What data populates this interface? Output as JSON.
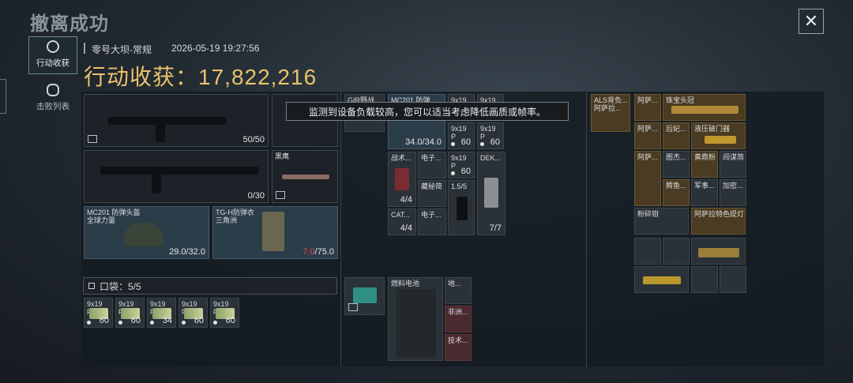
{
  "header": {
    "title": "撤离成功",
    "close_icon": "close-icon"
  },
  "side_tabs": [
    {
      "label": "行动收获",
      "icon": "loot-icon",
      "active": true
    },
    {
      "label": "击败列表",
      "icon": "skull-icon",
      "active": false
    }
  ],
  "meta": {
    "map": "零号大坝-常规",
    "time": "2026-05-19 19:27:56"
  },
  "harvest": {
    "label": "行动收获：",
    "value": "17,822,216"
  },
  "toast": "监测到设备负载较高，您可以适当考虑降低画质或帧率。",
  "equipment": {
    "primary_ammo": "50/50",
    "secondary_ammo": "0/30",
    "melee_label": "黑鹰",
    "helmet": {
      "name": "MC201 防弹头盔",
      "sub": "全球力量",
      "dur": "29.0/32.0"
    },
    "armor": {
      "name": "TG-H防弹衣",
      "sub": "三角洲",
      "dur_cur": "7.0",
      "dur_max": "/75.0"
    }
  },
  "pocket": {
    "label": "口袋：5/5",
    "ammo": [
      {
        "name": "9x19",
        "sub": "P",
        "count": "60"
      },
      {
        "name": "9x19",
        "sub": "P",
        "count": "60"
      },
      {
        "name": "9x19",
        "sub": "P",
        "count": "34"
      },
      {
        "name": "9x19",
        "sub": "P",
        "count": "60"
      },
      {
        "name": "9x19",
        "sub": "P",
        "count": "60"
      }
    ]
  },
  "chest": {
    "gir": "GIR野战",
    "mc201": {
      "name": "MC201 防弹",
      "dur": "34.0/34.0"
    },
    "ammo_top": [
      {
        "name": "9x19",
        "sub": "",
        "count": ""
      },
      {
        "name": "9x19",
        "sub": "",
        "count": ""
      },
      {
        "name": "9x19",
        "sub": "P",
        "count": "60"
      },
      {
        "name": "9x19",
        "sub": "P",
        "count": "60"
      }
    ],
    "rows": [
      {
        "label": "战术...",
        "count": "4/4"
      },
      {
        "label": "电子...",
        "count": ""
      },
      {
        "label": "9x19",
        "sub": "P",
        "count": "60"
      },
      {
        "label": "DEK...",
        "count": "7/7"
      },
      {
        "label": "藏秘简",
        "count": ""
      },
      {
        "label": "1.5/5",
        "count": ""
      },
      {
        "label": "CAT...",
        "count": "4/4"
      },
      {
        "label": "电子...",
        "count": ""
      }
    ]
  },
  "backpack": {
    "battery": "燃料电池",
    "side": [
      "地...",
      "非洲...",
      "技术..."
    ]
  },
  "stash": {
    "a": "ALS背负...",
    "a2": "阿萨拉...",
    "items": [
      "阿萨...",
      "珠宝头冠",
      "阿萨...",
      "后妃...",
      "液压破门器",
      "阿萨...",
      "图杰...",
      "黄鼎粉",
      "阎谋简",
      "鳄鱼...",
      "军事...",
      "加密...",
      "粉碎钳",
      "阿萨拉特色提灯"
    ]
  }
}
